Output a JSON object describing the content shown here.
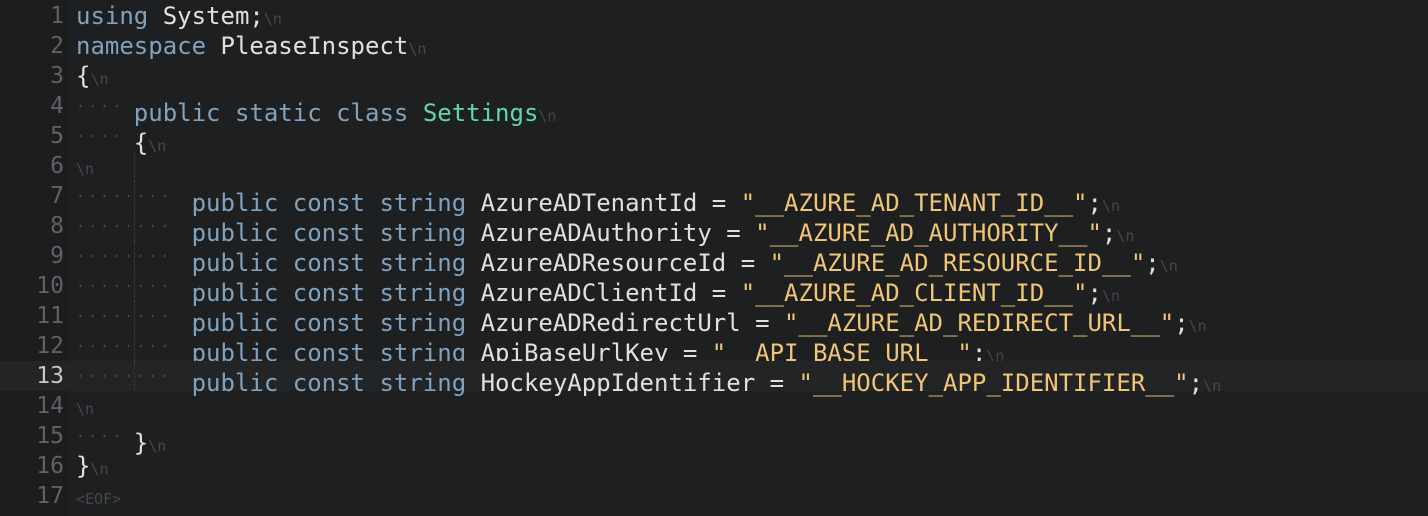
{
  "editor": {
    "line_numbers": [
      "1",
      "2",
      "3",
      "4",
      "5",
      "6",
      "7",
      "8",
      "9",
      "10",
      "11",
      "12",
      "13",
      "14",
      "15",
      "16",
      "17"
    ],
    "active_line": "13",
    "eol_marker": "\\n",
    "eof_marker": "<EOF>",
    "lines": [
      {
        "tokens": [
          {
            "t": "kw",
            "v": "using"
          },
          {
            "t": "tx",
            "v": " System;"
          }
        ]
      },
      {
        "tokens": [
          {
            "t": "kw",
            "v": "namespace"
          },
          {
            "t": "tx",
            "v": " PleaseInspect"
          }
        ]
      },
      {
        "tokens": [
          {
            "t": "tx",
            "v": "{"
          }
        ]
      },
      {
        "ws": 4,
        "tokens": [
          {
            "t": "kw",
            "v": "public"
          },
          {
            "t": "tx",
            "v": " "
          },
          {
            "t": "kw",
            "v": "static"
          },
          {
            "t": "tx",
            "v": " "
          },
          {
            "t": "kw",
            "v": "class"
          },
          {
            "t": "tx",
            "v": " "
          },
          {
            "t": "cls",
            "v": "Settings"
          }
        ]
      },
      {
        "ws": 4,
        "tokens": [
          {
            "t": "tx",
            "v": "{"
          }
        ]
      },
      {
        "tokens": []
      },
      {
        "ws": 8,
        "tokens": [
          {
            "t": "kw",
            "v": "public"
          },
          {
            "t": "tx",
            "v": " "
          },
          {
            "t": "kw",
            "v": "const"
          },
          {
            "t": "tx",
            "v": " "
          },
          {
            "t": "ty",
            "v": "string"
          },
          {
            "t": "tx",
            "v": " AzureADTenantId = "
          },
          {
            "t": "st",
            "v": "\"__AZURE_AD_TENANT_ID__\""
          },
          {
            "t": "tx",
            "v": ";"
          }
        ]
      },
      {
        "ws": 8,
        "tokens": [
          {
            "t": "kw",
            "v": "public"
          },
          {
            "t": "tx",
            "v": " "
          },
          {
            "t": "kw",
            "v": "const"
          },
          {
            "t": "tx",
            "v": " "
          },
          {
            "t": "ty",
            "v": "string"
          },
          {
            "t": "tx",
            "v": " AzureADAuthority = "
          },
          {
            "t": "st",
            "v": "\"__AZURE_AD_AUTHORITY__\""
          },
          {
            "t": "tx",
            "v": ";"
          }
        ]
      },
      {
        "ws": 8,
        "tokens": [
          {
            "t": "kw",
            "v": "public"
          },
          {
            "t": "tx",
            "v": " "
          },
          {
            "t": "kw",
            "v": "const"
          },
          {
            "t": "tx",
            "v": " "
          },
          {
            "t": "ty",
            "v": "string"
          },
          {
            "t": "tx",
            "v": " AzureADResourceId = "
          },
          {
            "t": "st",
            "v": "\"__AZURE_AD_RESOURCE_ID__\""
          },
          {
            "t": "tx",
            "v": ";"
          }
        ]
      },
      {
        "ws": 8,
        "tokens": [
          {
            "t": "kw",
            "v": "public"
          },
          {
            "t": "tx",
            "v": " "
          },
          {
            "t": "kw",
            "v": "const"
          },
          {
            "t": "tx",
            "v": " "
          },
          {
            "t": "ty",
            "v": "string"
          },
          {
            "t": "tx",
            "v": " AzureADClientId = "
          },
          {
            "t": "st",
            "v": "\"__AZURE_AD_CLIENT_ID__\""
          },
          {
            "t": "tx",
            "v": ";"
          }
        ]
      },
      {
        "ws": 8,
        "tokens": [
          {
            "t": "kw",
            "v": "public"
          },
          {
            "t": "tx",
            "v": " "
          },
          {
            "t": "kw",
            "v": "const"
          },
          {
            "t": "tx",
            "v": " "
          },
          {
            "t": "ty",
            "v": "string"
          },
          {
            "t": "tx",
            "v": " AzureADRedirectUrl = "
          },
          {
            "t": "st",
            "v": "\"__AZURE_AD_REDIRECT_URL__\""
          },
          {
            "t": "tx",
            "v": ";"
          }
        ]
      },
      {
        "ws": 8,
        "tokens": [
          {
            "t": "kw",
            "v": "public"
          },
          {
            "t": "tx",
            "v": " "
          },
          {
            "t": "kw",
            "v": "const"
          },
          {
            "t": "tx",
            "v": " "
          },
          {
            "t": "ty",
            "v": "string"
          },
          {
            "t": "tx",
            "v": " ApiBaseUrlKey = "
          },
          {
            "t": "st",
            "v": "\"__API_BASE_URL__\""
          },
          {
            "t": "tx",
            "v": ";"
          }
        ]
      },
      {
        "ws": 8,
        "tokens": [
          {
            "t": "kw",
            "v": "public"
          },
          {
            "t": "tx",
            "v": " "
          },
          {
            "t": "kw",
            "v": "const"
          },
          {
            "t": "tx",
            "v": " "
          },
          {
            "t": "ty",
            "v": "string"
          },
          {
            "t": "tx",
            "v": " HockeyAppIdentifier = "
          },
          {
            "t": "st",
            "v": "\"__HOCKEY_APP_IDENTIFIER__\""
          },
          {
            "t": "tx",
            "v": ";"
          }
        ]
      },
      {
        "tokens": []
      },
      {
        "ws": 4,
        "tokens": [
          {
            "t": "tx",
            "v": "}"
          }
        ]
      },
      {
        "tokens": [
          {
            "t": "tx",
            "v": "}"
          }
        ]
      },
      {
        "eof": true,
        "tokens": []
      }
    ]
  }
}
